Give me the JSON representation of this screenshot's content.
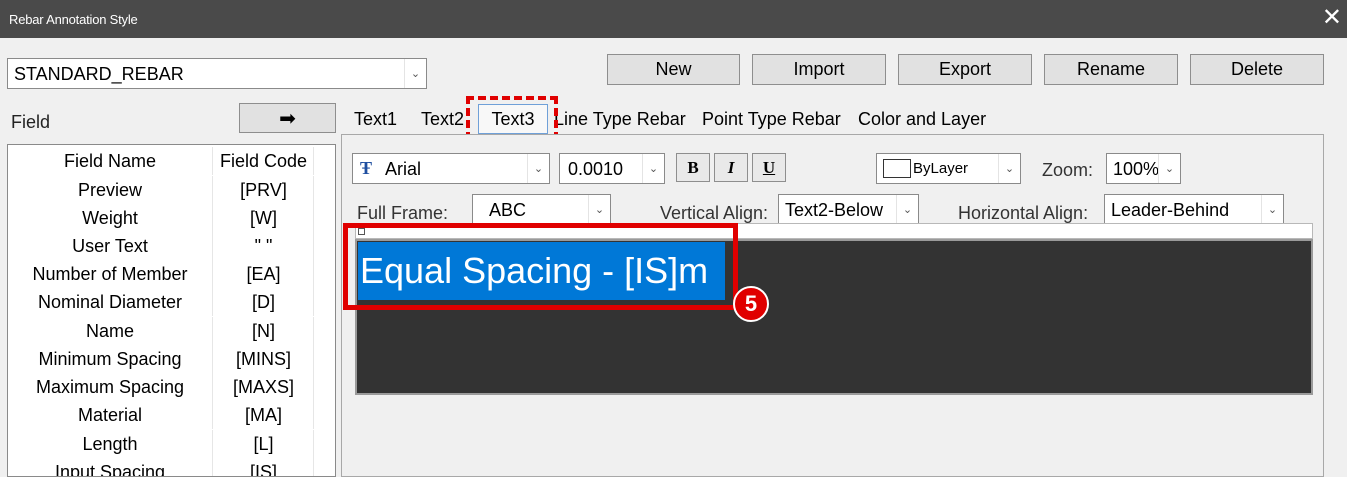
{
  "window": {
    "title": "Rebar Annotation Style",
    "close_symbol": "✕"
  },
  "style_select": {
    "value": "STANDARD_REBAR"
  },
  "buttons": {
    "new": "New",
    "import": "Import",
    "export": "Export",
    "rename": "Rename",
    "delete": "Delete",
    "arrow": "➡"
  },
  "field_panel": {
    "label": "Field",
    "headers": [
      "Field Name",
      "Field Code"
    ],
    "rows": [
      [
        "Preview",
        "[PRV]"
      ],
      [
        "Weight",
        "[W]"
      ],
      [
        "User Text",
        "\" \""
      ],
      [
        "Number of Member",
        "[EA]"
      ],
      [
        "Nominal Diameter",
        "[D]"
      ],
      [
        "Name",
        "[N]"
      ],
      [
        "Minimum Spacing",
        "[MINS]"
      ],
      [
        "Maximum Spacing",
        "[MAXS]"
      ],
      [
        "Material",
        "[MA]"
      ],
      [
        "Length",
        "[L]"
      ],
      [
        "Input Spacing",
        "[IS]"
      ]
    ]
  },
  "tabs": [
    "Text1",
    "Text2",
    "Text3",
    "Line Type Rebar",
    "Point Type Rebar",
    "Color and Layer"
  ],
  "active_tab_index": 2,
  "format": {
    "font_glyph": "Ŧ",
    "font": "Arial",
    "size": "0.0010",
    "bold": "B",
    "italic": "I",
    "underline": "U",
    "color": "ByLayer",
    "zoom_label": "Zoom:",
    "zoom": "100%"
  },
  "options": {
    "full_frame_label": "Full Frame:",
    "full_frame": "ABC",
    "valign_label": "Vertical Align:",
    "valign": "Text2-Below",
    "halign_label": "Horizontal Align:",
    "halign": "Leader-Behind"
  },
  "preview": {
    "text": "Equal Spacing - [IS]m"
  },
  "callout": {
    "number": "5"
  },
  "colors": {
    "accent_red": "#e00000",
    "selection_blue": "#0078d7",
    "title_bar": "#4a4a4a",
    "preview_bg": "#333333"
  }
}
